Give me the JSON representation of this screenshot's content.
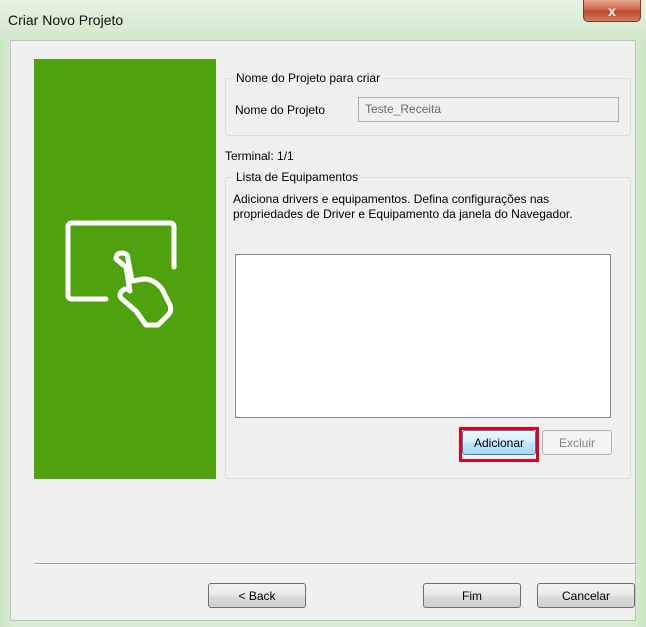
{
  "window": {
    "title": "Criar Novo Projeto",
    "close_label": "x"
  },
  "project_group": {
    "legend": "Nome do Projeto para criar",
    "name_label": "Nome do Projeto",
    "name_value": "Teste_Receita"
  },
  "terminal_label": "Terminal: 1/1",
  "equipment_group": {
    "legend": "Lista de Equipamentos",
    "description": "Adiciona drivers e equipamentos. Defina configurações nas propriedades de Driver e Equipamento da janela do Navegador.",
    "items": [],
    "add_label": "Adicionar",
    "delete_label": "Excluir"
  },
  "footer": {
    "back_label": "< Back",
    "finish_label": "Fim",
    "cancel_label": "Cancelar"
  },
  "icons": {
    "banner_icon": "touch-screen-hand-icon"
  },
  "colors": {
    "banner": "#4fa20d",
    "highlight": "#e4001c"
  }
}
